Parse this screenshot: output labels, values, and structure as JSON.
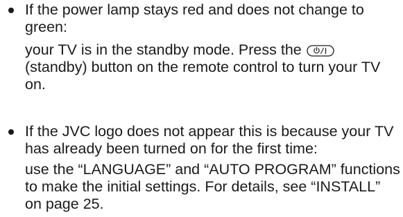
{
  "items": [
    {
      "condition": "If the power lamp stays red and does not change to green:",
      "action_before_icon": "your TV is in the standby mode. Press the ",
      "icon_label": "⏻/I",
      "action_after_icon": " (standby) button on the remote control to turn your TV on."
    },
    {
      "condition": "If the JVC logo does not appear this is because your TV has already been turned on for the first time:",
      "action": "use the “LANGUAGE” and “AUTO PROGRAM” functions to make the initial settings. For details, see “INSTALL” on page 25."
    }
  ]
}
